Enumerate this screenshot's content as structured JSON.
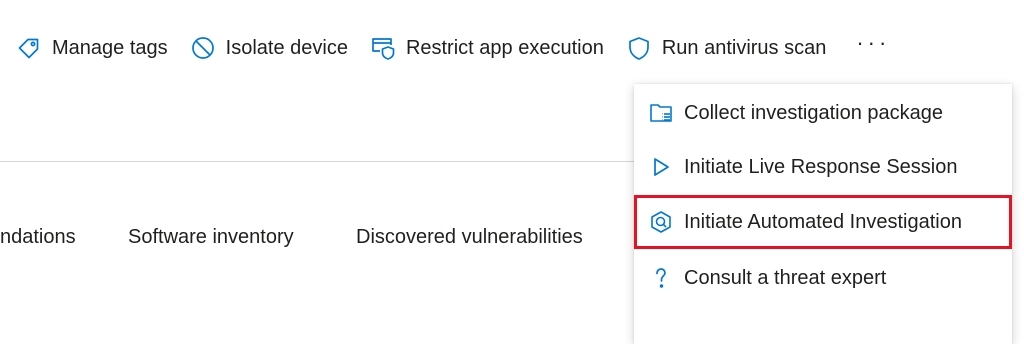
{
  "toolbar": {
    "manage_tags": {
      "label": "Manage tags",
      "icon": "tag-icon"
    },
    "isolate_device": {
      "label": "Isolate device",
      "icon": "block-icon"
    },
    "restrict_app": {
      "label": "Restrict app execution",
      "icon": "restrict-app-icon"
    },
    "antivirus": {
      "label": "Run antivirus scan",
      "icon": "shield-icon"
    },
    "more": {
      "label": "···",
      "icon": "more-icon"
    }
  },
  "tabs": [
    {
      "label": "ndations"
    },
    {
      "label": "Software inventory"
    },
    {
      "label": "Discovered vulnerabilities"
    }
  ],
  "menu": {
    "items": [
      {
        "label": "Collect investigation package",
        "icon": "folder-list-icon"
      },
      {
        "label": "Initiate Live Response Session",
        "icon": "play-icon"
      },
      {
        "label": "Initiate Automated Investigation",
        "icon": "investigation-icon",
        "highlighted": true
      },
      {
        "label": "Consult a threat expert",
        "icon": "question-icon"
      }
    ]
  },
  "colors": {
    "accent": "#0078d4",
    "highlight_border": "#e81123",
    "text": "#201f1e"
  }
}
